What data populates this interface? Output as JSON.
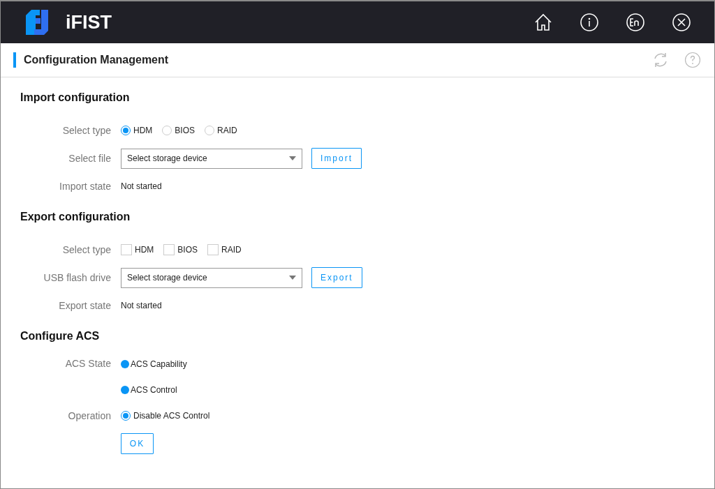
{
  "header": {
    "app_name": "iFIST"
  },
  "page": {
    "title": "Configuration Management"
  },
  "sections": [
    {
      "title": "Import configuration",
      "rows": [
        {
          "kind": "radio",
          "label": "Select type",
          "options": [
            {
              "label": "HDM",
              "selected": true
            },
            {
              "label": "BIOS",
              "selected": false
            },
            {
              "label": "RAID",
              "selected": false
            }
          ]
        },
        {
          "kind": "select",
          "label": "Select file",
          "value": "Select storage device",
          "button": "Import"
        },
        {
          "kind": "text",
          "label": "Import state",
          "value": "Not started"
        }
      ]
    },
    {
      "title": "Export configuration",
      "rows": [
        {
          "kind": "checkbox",
          "label": "Select type",
          "options": [
            {
              "label": "HDM",
              "checked": false
            },
            {
              "label": "BIOS",
              "checked": false
            },
            {
              "label": "RAID",
              "checked": false
            }
          ]
        },
        {
          "kind": "select",
          "label": "USB flash drive",
          "value": "Select storage device",
          "button": "Export"
        },
        {
          "kind": "text",
          "label": "Export state",
          "value": "Not started"
        }
      ]
    },
    {
      "title": "Configure ACS",
      "rows": [
        {
          "kind": "indicators",
          "label": "ACS State",
          "items": [
            {
              "label": "ACS Capability",
              "on": true
            },
            {
              "label": "ACS Control",
              "on": true
            }
          ]
        },
        {
          "kind": "radio",
          "label": "Operation",
          "options": [
            {
              "label": "Disable ACS Control",
              "selected": true
            }
          ]
        },
        {
          "kind": "button",
          "label": "OK"
        }
      ]
    }
  ]
}
